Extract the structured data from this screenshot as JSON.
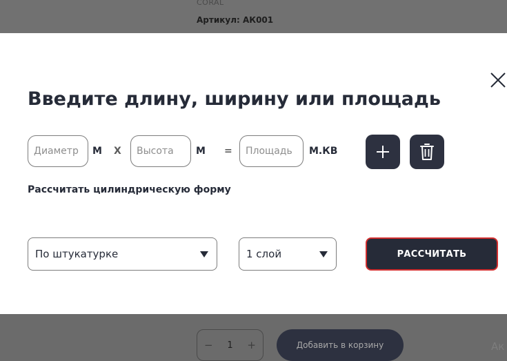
{
  "background": {
    "brand": "CORAL",
    "sku_label": "Артикул:",
    "sku_value": "АК001",
    "quantity": "1",
    "minus": "−",
    "plus": "+",
    "add_to_cart": "Добавить в корзину",
    "edge_text": "Ак"
  },
  "modal": {
    "title": "Введите длину, ширину или площадь",
    "diameter_placeholder": "Диаметр",
    "height_placeholder": "Высота",
    "area_placeholder": "Площадь",
    "unit_m": "М",
    "unit_m2": "М",
    "unit_sq": "М.КВ",
    "times": "Х",
    "equals": "=",
    "cylinder_link": "Рассчитать цилиндрическую форму",
    "surface_select": "По штукатурке",
    "layers_select": "1 слой",
    "calculate_button": "РАССЧИТАТЬ"
  },
  "icons": {
    "close": "close-icon",
    "add": "plus-icon",
    "delete": "trash-icon",
    "dropdown": "triangle-down-icon"
  },
  "colors": {
    "dark": "#262b38",
    "accent_border": "#d32e2e",
    "overlay": "#6b6b6b"
  }
}
